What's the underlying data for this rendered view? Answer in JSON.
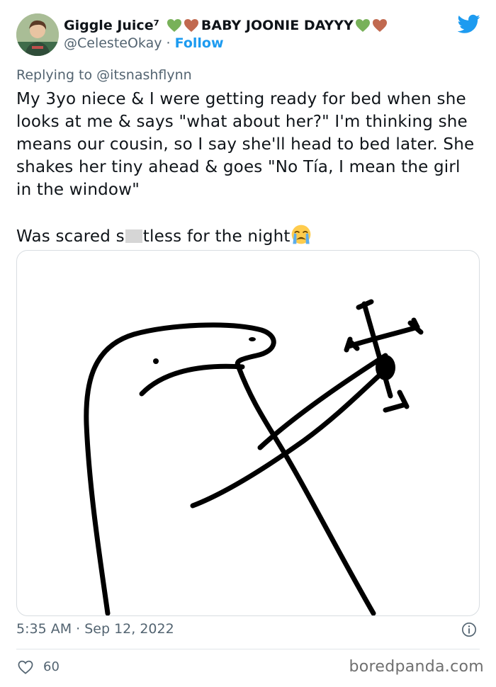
{
  "author": {
    "display_name": "Giggle Juice⁷",
    "display_name_suffix": "BABY JOONIE DAYYY",
    "handle": "@CelesteOkay",
    "separator": "·",
    "follow_label": "Follow"
  },
  "reply": {
    "prefix": "Replying to",
    "handle": "@itsnashflynn"
  },
  "tweet": {
    "paragraph1": "My 3yo niece & I were getting ready for bed when she looks at me & says \"what about her?\" I'm thinking she means our cousin, so I say she'll head to bed later. She shakes her tiny ahead & goes \"No Tía, I mean the girl in the window\"",
    "paragraph2_start": "Was scared s",
    "paragraph2_end": "tless for the night"
  },
  "meta": {
    "timestamp": "5:35 AM · Sep 12, 2022",
    "like_count": "60"
  },
  "watermark": "boredpanda.com",
  "colors": {
    "accent": "#1d9bf0",
    "green_heart": "#78b159",
    "brown_heart": "#c1694f",
    "secondary_text": "#536471"
  },
  "icons": [
    "twitter-bird-icon",
    "green-heart-icon",
    "brown-heart-icon",
    "crying-face-emoji",
    "info-icon",
    "heart-icon"
  ]
}
